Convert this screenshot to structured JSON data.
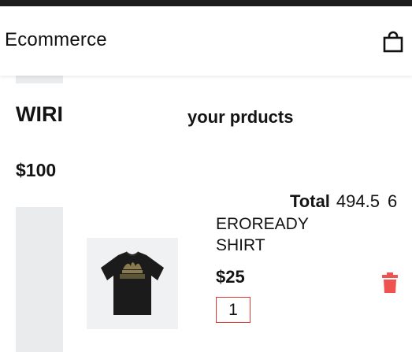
{
  "app_bar": {
    "title": "Ecommerce",
    "cart_icon": "shopping-bag-icon"
  },
  "background_product": {
    "title": "WIRI",
    "price": "$100"
  },
  "cart": {
    "heading": "your prducts",
    "total_label": "Total",
    "total_value": "494.5",
    "total_count": "6",
    "items": [
      {
        "name": "EROREADY SHIRT",
        "price": "$25",
        "quantity": "1",
        "image": "black-tshirt-image",
        "delete_icon": "trash-icon"
      }
    ]
  },
  "colors": {
    "accent_red": "#e53935",
    "placeholder_gray": "#eaebed",
    "text": "#141414"
  }
}
